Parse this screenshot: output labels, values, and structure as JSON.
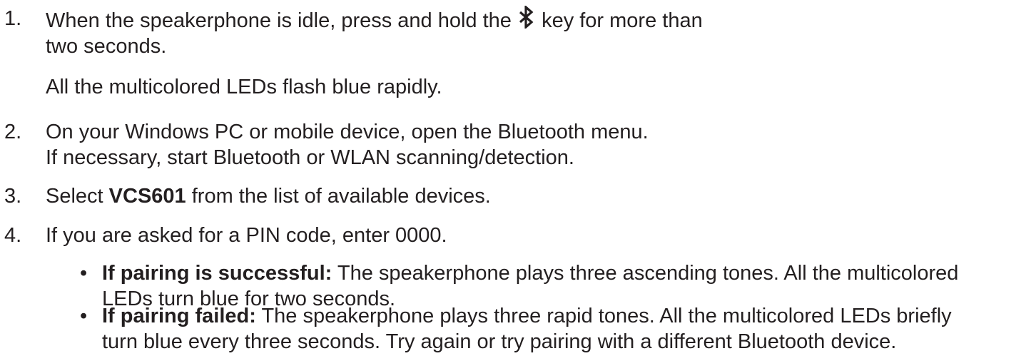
{
  "steps": [
    {
      "number": "1.",
      "line1_before_icon": "When the speakerphone is idle, press and hold the",
      "icon": "bluetooth-icon",
      "line1_after_icon": "key for more than",
      "line2": "two seconds."
    },
    {
      "number": "2.",
      "line1": "On your Windows PC or mobile device, open the Bluetooth menu.",
      "line2": "If necessary, start Bluetooth or WLAN scanning/detection."
    },
    {
      "number": "3.",
      "before_bold": "Select",
      "bold": "VCS601",
      "after_bold": "from the list of available devices."
    },
    {
      "number": "4.",
      "text": "If you are asked for a PIN code, enter 0000."
    }
  ],
  "step1_result": "All the multicolored LEDs flash blue rapidly.",
  "bullets": [
    {
      "marker": "•",
      "label": "If pairing is successful:",
      "line1": "The speakerphone plays three ascending tones. All the multicolored",
      "line2": "LEDs turn blue for two seconds."
    },
    {
      "marker": "•",
      "label": "If pairing failed:",
      "line1": "The speakerphone plays three rapid tones. All the multicolored LEDs briefly",
      "line2": "turn blue every three seconds. Try again or try pairing with a different Bluetooth device."
    }
  ]
}
